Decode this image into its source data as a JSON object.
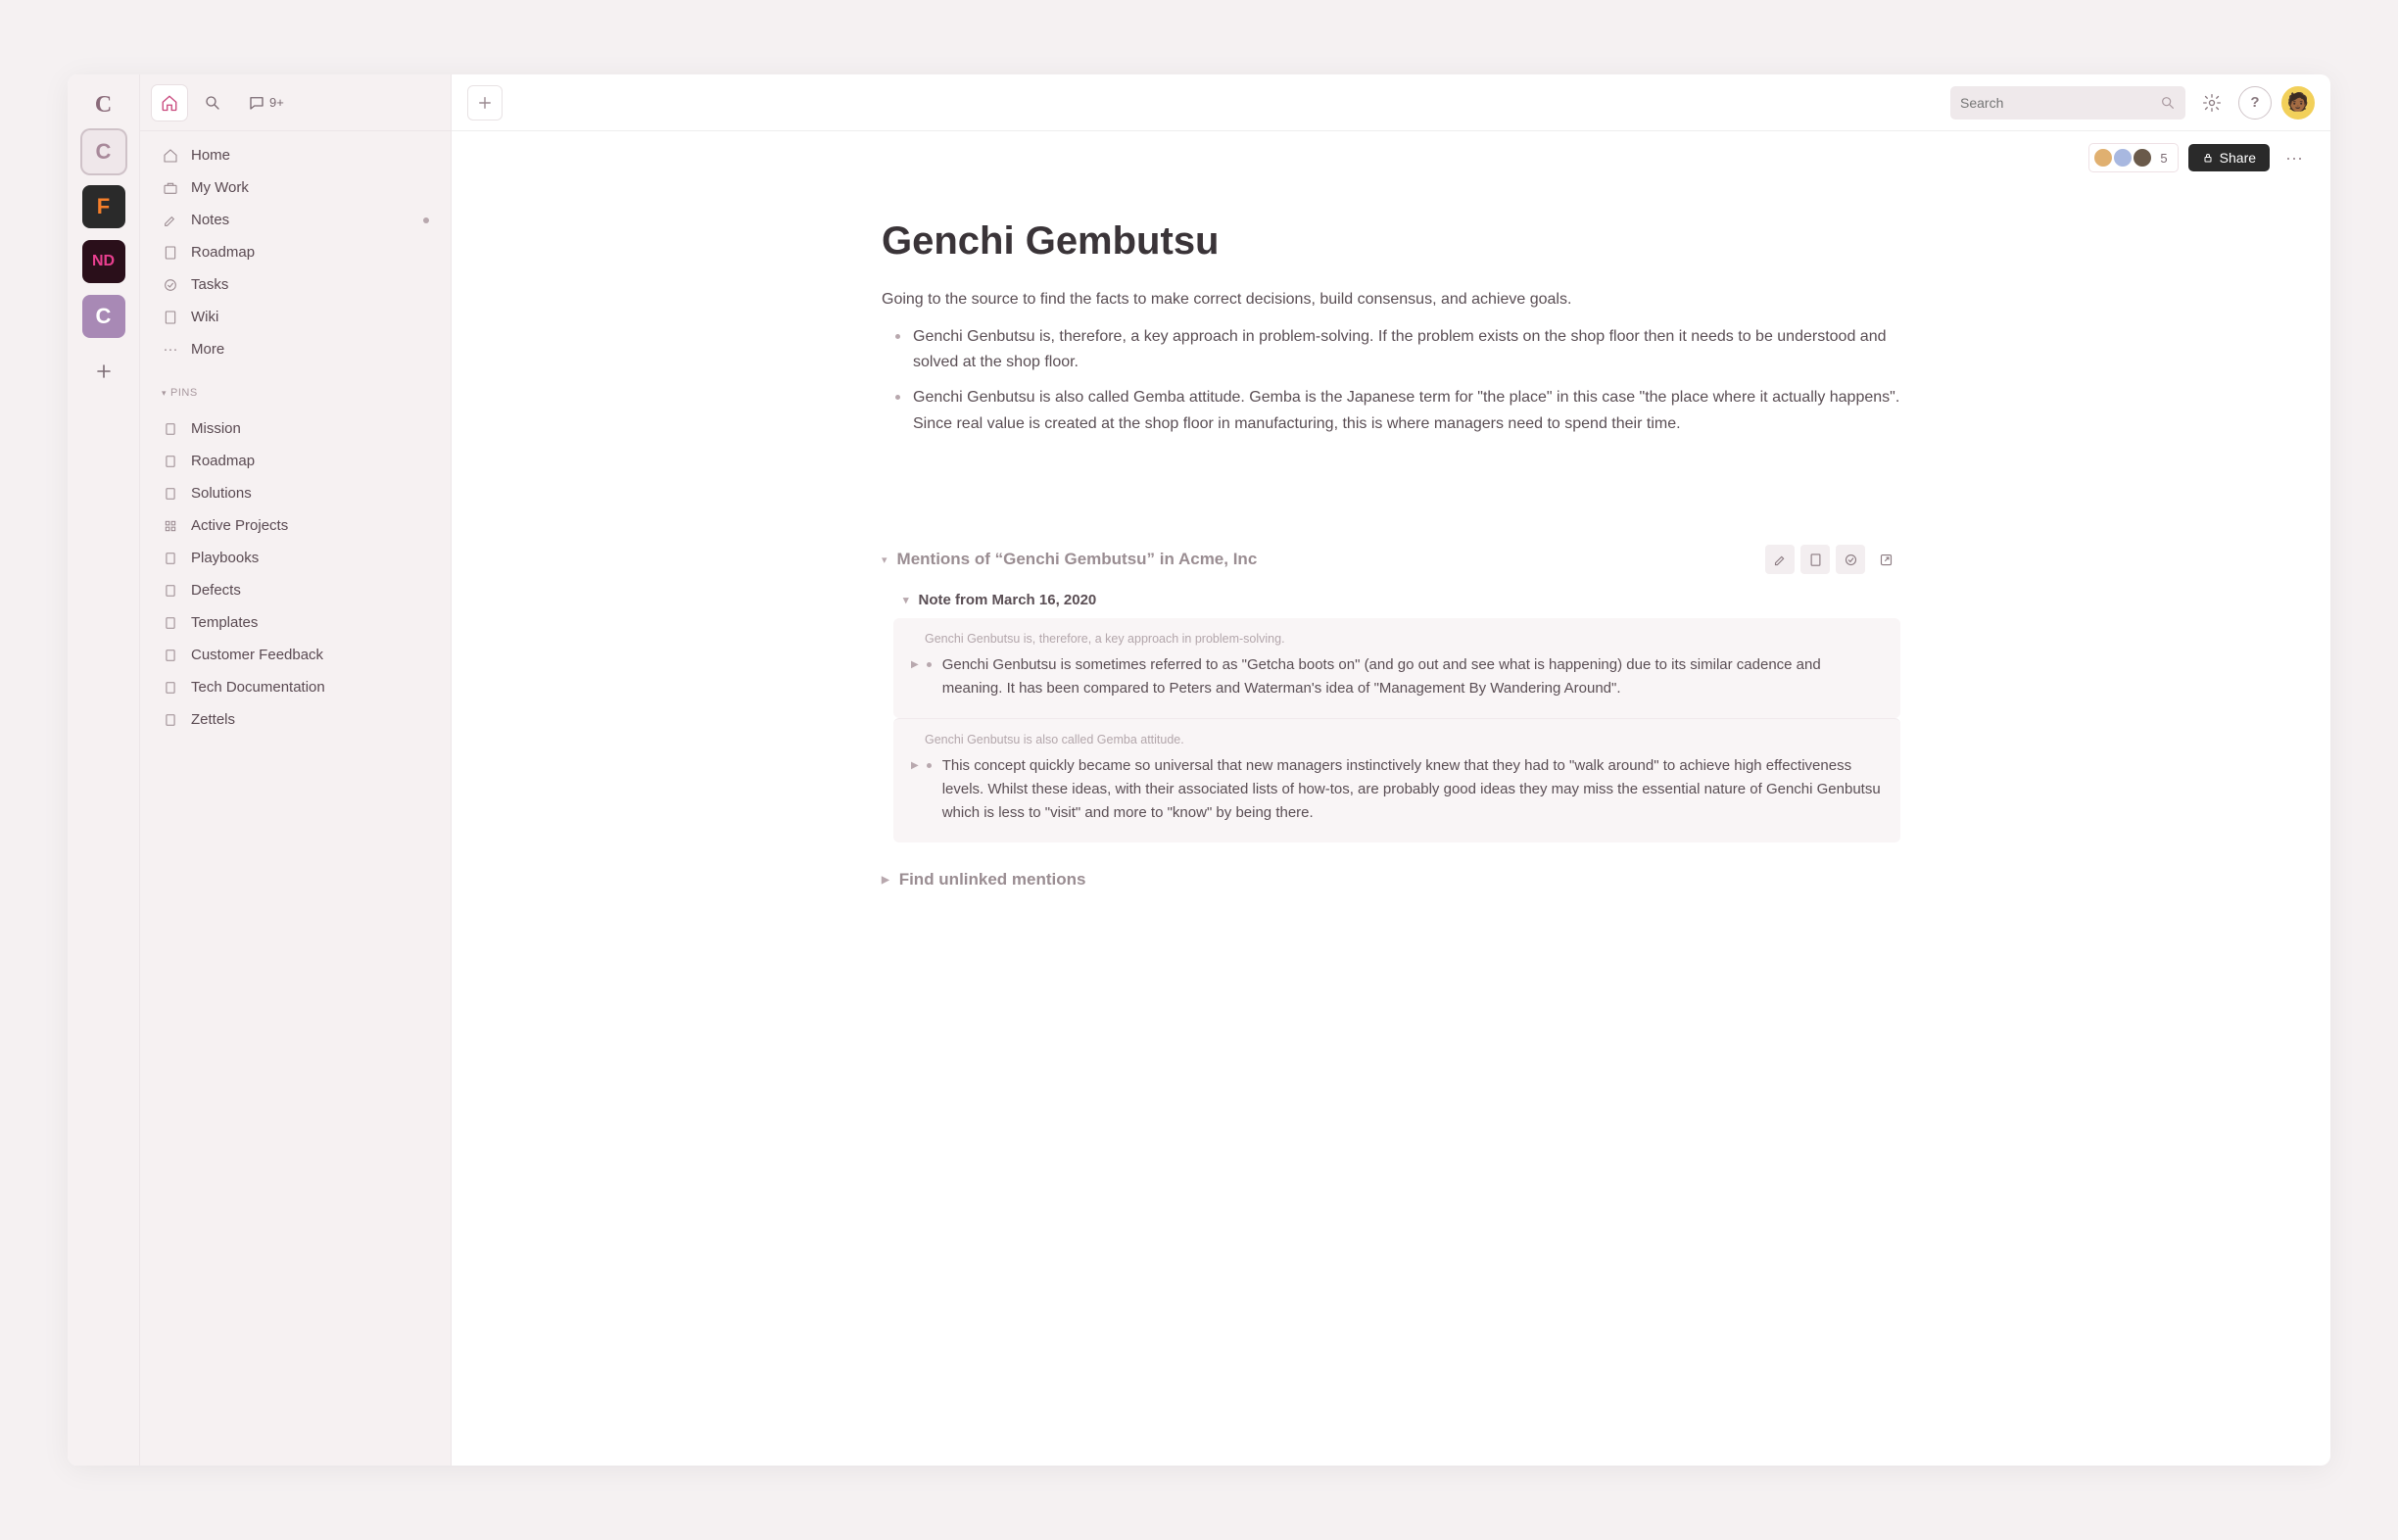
{
  "rail": {
    "items": [
      {
        "label": "C",
        "variant": "logo"
      },
      {
        "label": "C",
        "variant": "selected"
      },
      {
        "label": "F",
        "variant": "orange"
      },
      {
        "label": "ND",
        "variant": "nd"
      },
      {
        "label": "C",
        "variant": "purple"
      }
    ]
  },
  "sidebar": {
    "chat_badge": "9+",
    "nav": [
      {
        "icon": "home",
        "label": "Home"
      },
      {
        "icon": "briefcase",
        "label": "My Work"
      },
      {
        "icon": "edit",
        "label": "Notes",
        "dot": true
      },
      {
        "icon": "doc",
        "label": "Roadmap"
      },
      {
        "icon": "check",
        "label": "Tasks"
      },
      {
        "icon": "doc",
        "label": "Wiki"
      },
      {
        "icon": "more",
        "label": "More"
      }
    ],
    "pins_label": "PINS",
    "pins": [
      {
        "label": "Mission"
      },
      {
        "label": "Roadmap"
      },
      {
        "label": "Solutions"
      },
      {
        "label": "Active Projects",
        "icon": "grid"
      },
      {
        "label": "Playbooks"
      },
      {
        "label": "Defects"
      },
      {
        "label": "Templates"
      },
      {
        "label": "Customer Feedback"
      },
      {
        "label": "Tech Documentation"
      },
      {
        "label": "Zettels"
      }
    ]
  },
  "topbar": {
    "search_placeholder": "Search"
  },
  "action_row": {
    "collaborator_count": "5",
    "share_label": "Share"
  },
  "doc": {
    "title": "Genchi Gembutsu",
    "intro": "Going to the source to find the facts to make correct decisions, build consensus, and achieve goals.",
    "bullets": [
      "Genchi Genbutsu is, therefore, a key approach in problem-solving. If the problem exists on the shop floor then it needs to be understood and solved at the shop floor.",
      "Genchi Genbutsu is also called Gemba attitude. Gemba is the Japanese term for \"the place\" in this case \"the place where it actually happens\". Since real value is created at the shop floor in manufacturing, this is where managers need to spend their time."
    ],
    "mentions_label": "Mentions of “Genchi Gembutsu” in Acme, Inc",
    "note_label": "Note from March 16, 2020",
    "mentions": [
      {
        "context": "Genchi Genbutsu is, therefore, a key approach in problem-solving.",
        "body": "Genchi Genbutsu is sometimes referred to as \"Getcha boots on\" (and go out and see what is happening) due to its similar cadence and meaning. It has been compared to Peters and Waterman's idea of \"Management By Wandering Around\"."
      },
      {
        "context": "Genchi Genbutsu is also called Gemba attitude.",
        "body": "This concept quickly became so universal that new managers instinctively knew that they had to \"walk around\" to achieve high effectiveness levels. Whilst these ideas, with their associated lists of how-tos, are probably good ideas they may miss the essential nature of Genchi Genbutsu which is less to \"visit\" and more to \"know\" by being there."
      }
    ],
    "unlinked_label": "Find unlinked mentions"
  }
}
